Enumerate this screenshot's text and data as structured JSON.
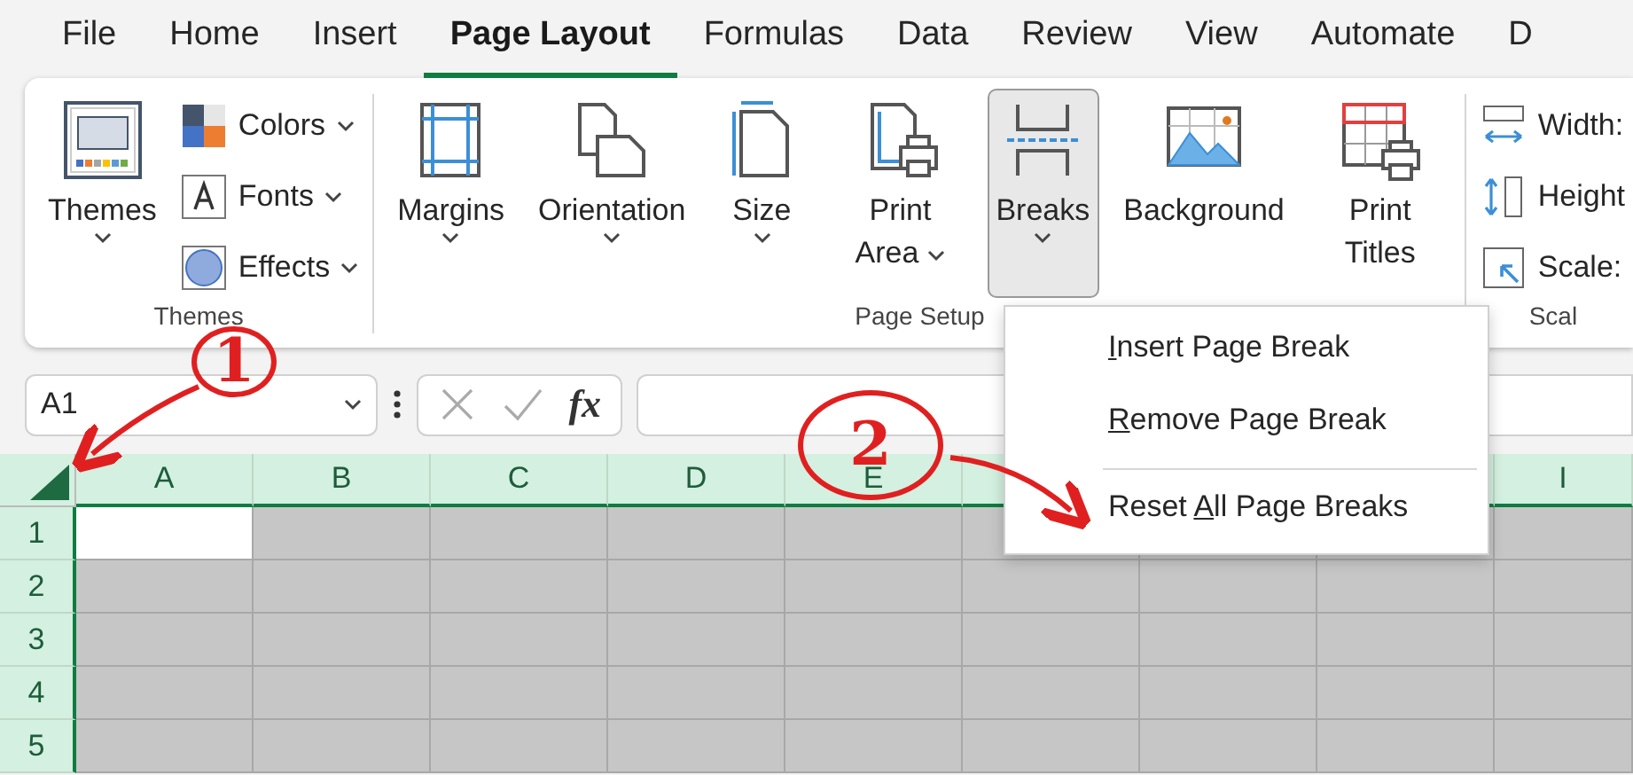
{
  "menu_tabs": [
    {
      "label": "File",
      "selected": false
    },
    {
      "label": "Home",
      "selected": false
    },
    {
      "label": "Insert",
      "selected": false
    },
    {
      "label": "Page Layout",
      "selected": true
    },
    {
      "label": "Formulas",
      "selected": false
    },
    {
      "label": "Data",
      "selected": false
    },
    {
      "label": "Review",
      "selected": false
    },
    {
      "label": "View",
      "selected": false
    },
    {
      "label": "Automate",
      "selected": false
    },
    {
      "label": "D",
      "selected": false
    }
  ],
  "ribbon_groups": [
    {
      "label": "Themes",
      "buttons": [
        {
          "kind": "large",
          "label": "Themes",
          "dropdown": true,
          "pressed": false
        },
        {
          "kind": "stack",
          "items": [
            {
              "label": "Colors",
              "dropdown": true
            },
            {
              "label": "Fonts",
              "dropdown": true
            },
            {
              "label": "Effects",
              "dropdown": true
            }
          ]
        }
      ]
    },
    {
      "label": "Page Setup",
      "buttons": [
        {
          "kind": "large",
          "label": "Margins",
          "dropdown": true,
          "pressed": false
        },
        {
          "kind": "large",
          "label": "Orientation",
          "dropdown": true,
          "pressed": false
        },
        {
          "kind": "large",
          "label": "Size",
          "dropdown": true,
          "pressed": false
        },
        {
          "kind": "large",
          "label": "Print Area",
          "dropdown": true,
          "pressed": false
        },
        {
          "kind": "large",
          "label": "Breaks",
          "dropdown": true,
          "pressed": true
        },
        {
          "kind": "large",
          "label": "Background",
          "dropdown": false,
          "pressed": false
        },
        {
          "kind": "large",
          "label": "Print Titles",
          "dropdown": false,
          "pressed": false
        }
      ]
    },
    {
      "label": "Scal",
      "buttons": [
        {
          "kind": "stack",
          "items": [
            {
              "label": "Width:",
              "dropdown": false
            },
            {
              "label": "Height",
              "dropdown": false
            },
            {
              "label": "Scale:",
              "dropdown": false
            }
          ]
        }
      ]
    }
  ],
  "formula_bar": {
    "name_box": "A1",
    "fx": "fx"
  },
  "sheet": {
    "columns": [
      "A",
      "B",
      "C",
      "D",
      "E",
      null,
      null,
      null,
      "I"
    ],
    "rows": [
      "1",
      "2",
      "3",
      "4",
      "5"
    ]
  },
  "breaks_menu": [
    {
      "key": "I",
      "after": "nsert Page Break"
    },
    {
      "key": "R",
      "after": "emove Page Break"
    },
    {
      "before": "Reset ",
      "key": "A",
      "after": "ll Page Breaks"
    }
  ],
  "annotations": [
    {
      "label": "1"
    },
    {
      "label": "2"
    }
  ]
}
